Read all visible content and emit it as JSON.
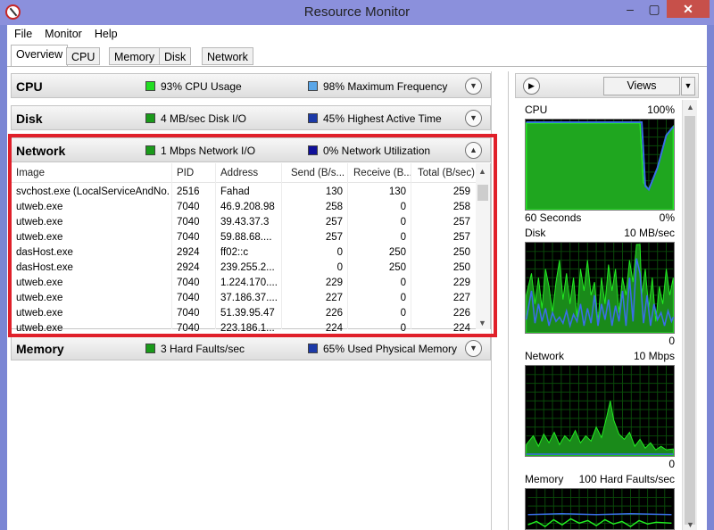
{
  "window": {
    "title": "Resource Monitor",
    "min_glyph": "–",
    "max_glyph": "▢",
    "close_glyph": "✕"
  },
  "menu": [
    "File",
    "Monitor",
    "Help"
  ],
  "tabs": [
    {
      "label": "Overview",
      "active": true
    },
    {
      "label": "CPU"
    },
    {
      "label": "Memory"
    },
    {
      "label": "Disk"
    },
    {
      "label": "Network"
    }
  ],
  "panels": {
    "cpu": {
      "title": "CPU",
      "stat1": "93% CPU Usage",
      "stat1_color": "#22dd22",
      "stat2": "98% Maximum Frequency",
      "stat2_color": "#5aa6e8"
    },
    "disk": {
      "title": "Disk",
      "stat1": "4 MB/sec Disk I/O",
      "stat1_color": "#1a9a1a",
      "stat2": "45% Highest Active Time",
      "stat2_color": "#1c3aa8"
    },
    "network": {
      "title": "Network",
      "stat1": "1 Mbps Network I/O",
      "stat1_color": "#1a9a1a",
      "stat2": "0% Network Utilization",
      "stat2_color": "#10109a"
    },
    "memory": {
      "title": "Memory",
      "stat1": "3 Hard Faults/sec",
      "stat1_color": "#1a9a1a",
      "stat2": "65% Used Physical Memory",
      "stat2_color": "#1c3aa8"
    }
  },
  "network_table": {
    "columns": [
      "Image",
      "PID",
      "Address",
      "Send (B/s...",
      "Receive (B...",
      "Total (B/sec)"
    ],
    "rows": [
      [
        "svchost.exe (LocalServiceAndNo...",
        "2516",
        "Fahad",
        "130",
        "130",
        "259"
      ],
      [
        "utweb.exe",
        "7040",
        "46.9.208.98",
        "258",
        "0",
        "258"
      ],
      [
        "utweb.exe",
        "7040",
        "39.43.37.3",
        "257",
        "0",
        "257"
      ],
      [
        "utweb.exe",
        "7040",
        "59.88.68....",
        "257",
        "0",
        "257"
      ],
      [
        "dasHost.exe",
        "2924",
        "ff02::c",
        "0",
        "250",
        "250"
      ],
      [
        "dasHost.exe",
        "2924",
        "239.255.2...",
        "0",
        "250",
        "250"
      ],
      [
        "utweb.exe",
        "7040",
        "1.224.170....",
        "229",
        "0",
        "229"
      ],
      [
        "utweb.exe",
        "7040",
        "37.186.37....",
        "227",
        "0",
        "227"
      ],
      [
        "utweb.exe",
        "7040",
        "51.39.95.47",
        "226",
        "0",
        "226"
      ],
      [
        "utweb.exe",
        "7040",
        "223.186.1...",
        "224",
        "0",
        "224"
      ]
    ]
  },
  "right_pane": {
    "views_label": "Views",
    "graphs": {
      "cpu": {
        "label": "CPU",
        "max": "100%",
        "footer_left": "60 Seconds",
        "footer_right": "0%"
      },
      "disk": {
        "label": "Disk",
        "max": "10 MB/sec",
        "footer_right": "0"
      },
      "network": {
        "label": "Network",
        "max": "10 Mbps",
        "footer_right": "0"
      },
      "memory": {
        "label": "Memory",
        "max": "100 Hard Faults/sec"
      }
    }
  }
}
